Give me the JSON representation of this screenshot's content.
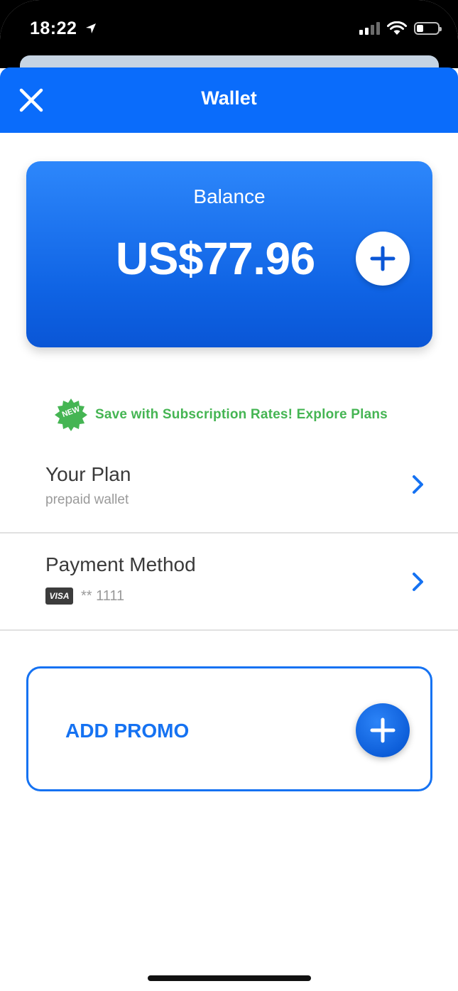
{
  "status_bar": {
    "time": "18:22",
    "location_icon": "location-arrow-icon",
    "signal_icon": "cellular-signal-icon",
    "wifi_icon": "wifi-icon",
    "battery_icon": "battery-icon",
    "battery_level": 0.25
  },
  "header": {
    "title": "Wallet",
    "close_icon": "close-icon",
    "background": "#0a6cfb"
  },
  "balance": {
    "label": "Balance",
    "amount": "US$77.96",
    "add_icon": "plus-icon"
  },
  "promo_banner": {
    "badge": "NEW",
    "text": "Save with Subscription Rates! Explore Plans",
    "color": "#45b553"
  },
  "plan": {
    "title": "Your Plan",
    "subtitle": "prepaid wallet",
    "chevron_icon": "chevron-right-icon"
  },
  "payment": {
    "title": "Payment Method",
    "card_brand": "VISA",
    "card_digits": "** 1111",
    "chevron_icon": "chevron-right-icon"
  },
  "add_promo": {
    "label": "ADD PROMO",
    "add_icon": "plus-icon",
    "accent": "#1572f2"
  }
}
